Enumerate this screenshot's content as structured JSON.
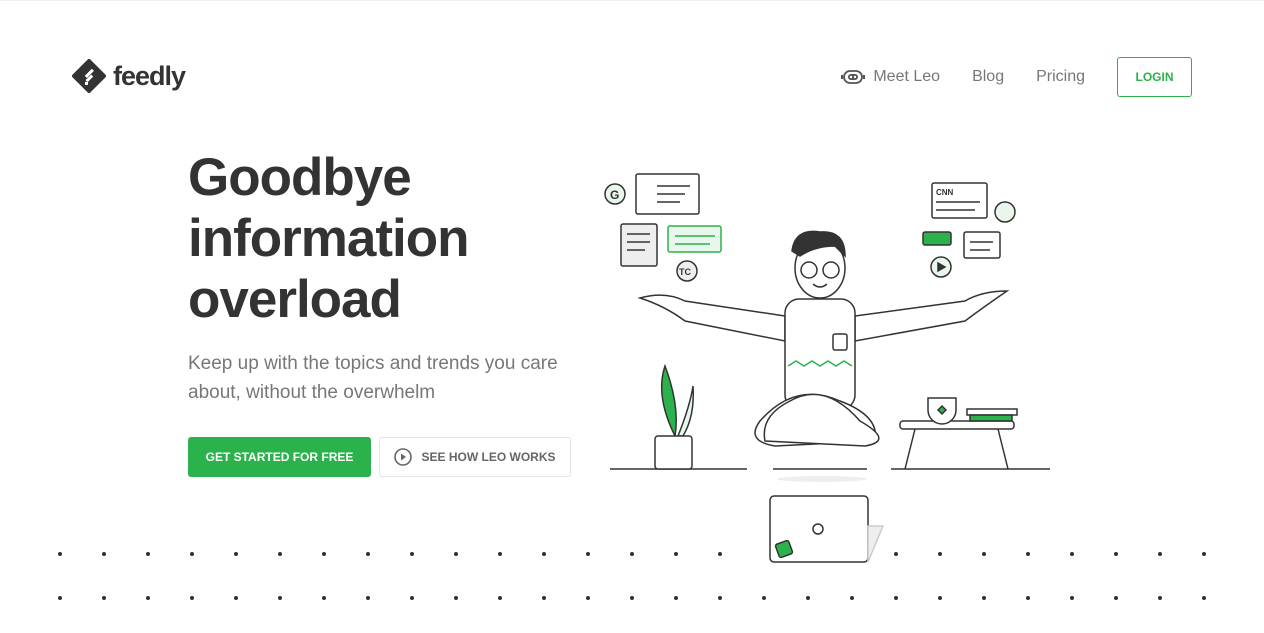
{
  "header": {
    "logo_text": "feedly",
    "nav": [
      {
        "label": "Meet Leo",
        "icon": "robot-icon"
      },
      {
        "label": "Blog"
      },
      {
        "label": "Pricing"
      }
    ],
    "login_label": "LOGIN"
  },
  "hero": {
    "title": "Goodbye information overload",
    "subtitle": "Keep up with the topics and trends you care about, without the overwhelm",
    "cta_primary": "GET STARTED FOR FREE",
    "cta_secondary": "SEE HOW LEO WORKS",
    "cta_secondary_icon": "play-circle-icon"
  },
  "illustration": {
    "logo_letters": [
      "G",
      "TC",
      "CNN"
    ]
  },
  "colors": {
    "brand": "#2bb24c",
    "text": "#333333",
    "muted": "#777777"
  }
}
